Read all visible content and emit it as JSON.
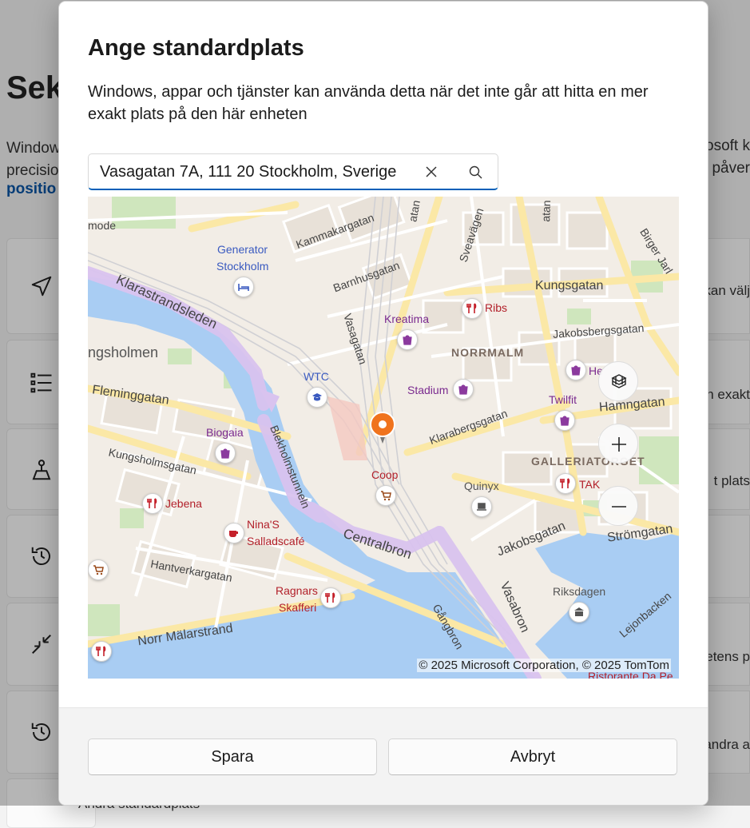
{
  "background": {
    "title": "Sek",
    "desc_line1": "Window",
    "desc_line2": "precisio",
    "link": "positio",
    "right_line1": "osoft k",
    "right_line2": "påver",
    "rows": [
      "kan välj",
      "n exakt",
      "t plats",
      "",
      "etens p",
      "andra a"
    ],
    "bottom_text": "Ändra standardplats"
  },
  "dialog": {
    "title": "Ange standardplats",
    "description": "Windows, appar och tjänster kan använda detta när det inte går att hitta en mer exakt plats på den här enheten",
    "search": {
      "value": "Vasagatan 7A, 111 20 Stockholm, Sverige",
      "placeholder": ""
    },
    "map": {
      "copyright": "© 2025 Microsoft Corporation, © 2025 TomTom",
      "labels": {
        "generator": "Generator",
        "stockholm": "Stockholm",
        "kammakargatan": "Kammakargatan",
        "sveavagen": "Sveavägen",
        "birger": "Birger Jarl",
        "mode": "mode",
        "klarastrandsleden": "Klarastrandsleden",
        "barnhusgatan": "Barnhusgatan",
        "kungsgatan": "Kungsgatan",
        "ribs": "Ribs",
        "kreatima": "Kreatima",
        "jakobsbergsgatan": "Jakobsbergsgatan",
        "kungsholmen": "ngsholmen",
        "normalm": "NORRMALM",
        "vasagatan": "Vasagatan",
        "wtc": "WTC",
        "he": "He",
        "fleminggatan": "Fleminggatan",
        "stadium": "Stadium",
        "twilfit": "Twilfit",
        "hamngatan": "Hamngatan",
        "biogaia": "Biogaia",
        "blekholmstunneln": "Blekholmstunneln",
        "klarabergsgatan": "Klarabergsgatan",
        "kungsholmsgatan": "Kungsholmsgatan",
        "gallerian": "GALLERIATORGET",
        "coop": "Coop",
        "quinyx": "Quinyx",
        "tak": "TAK",
        "jebena": "Jebena",
        "ninas1": "Nina'S",
        "ninas2": "Salladscafé",
        "centralbron": "Centralbron",
        "jakobsgatan": "Jakobsgatan",
        "stromgatan": "Strömgatan",
        "hantverkargatan": "Hantverkargatan",
        "ragnars1": "Ragnars",
        "ragnars2": "Skafferi",
        "riksdagen": "Riksdagen",
        "vasabron": "Vasabron",
        "lejonbacken": "Lejonbacken",
        "norrmalarstrand": "Norr Mälarstrand",
        "gangbron": "Gångbron",
        "ristorante": "Ristorante Da Pe",
        "natan": "atan"
      }
    },
    "buttons": {
      "save": "Spara",
      "cancel": "Avbryt"
    }
  },
  "colors": {
    "accent": "#005fb8",
    "water": "#a9cdf3",
    "park": "#cfe6bd",
    "road_major": "#fbe8a6",
    "tunnel": "#d9c3ef",
    "pin": "#f0731d"
  }
}
